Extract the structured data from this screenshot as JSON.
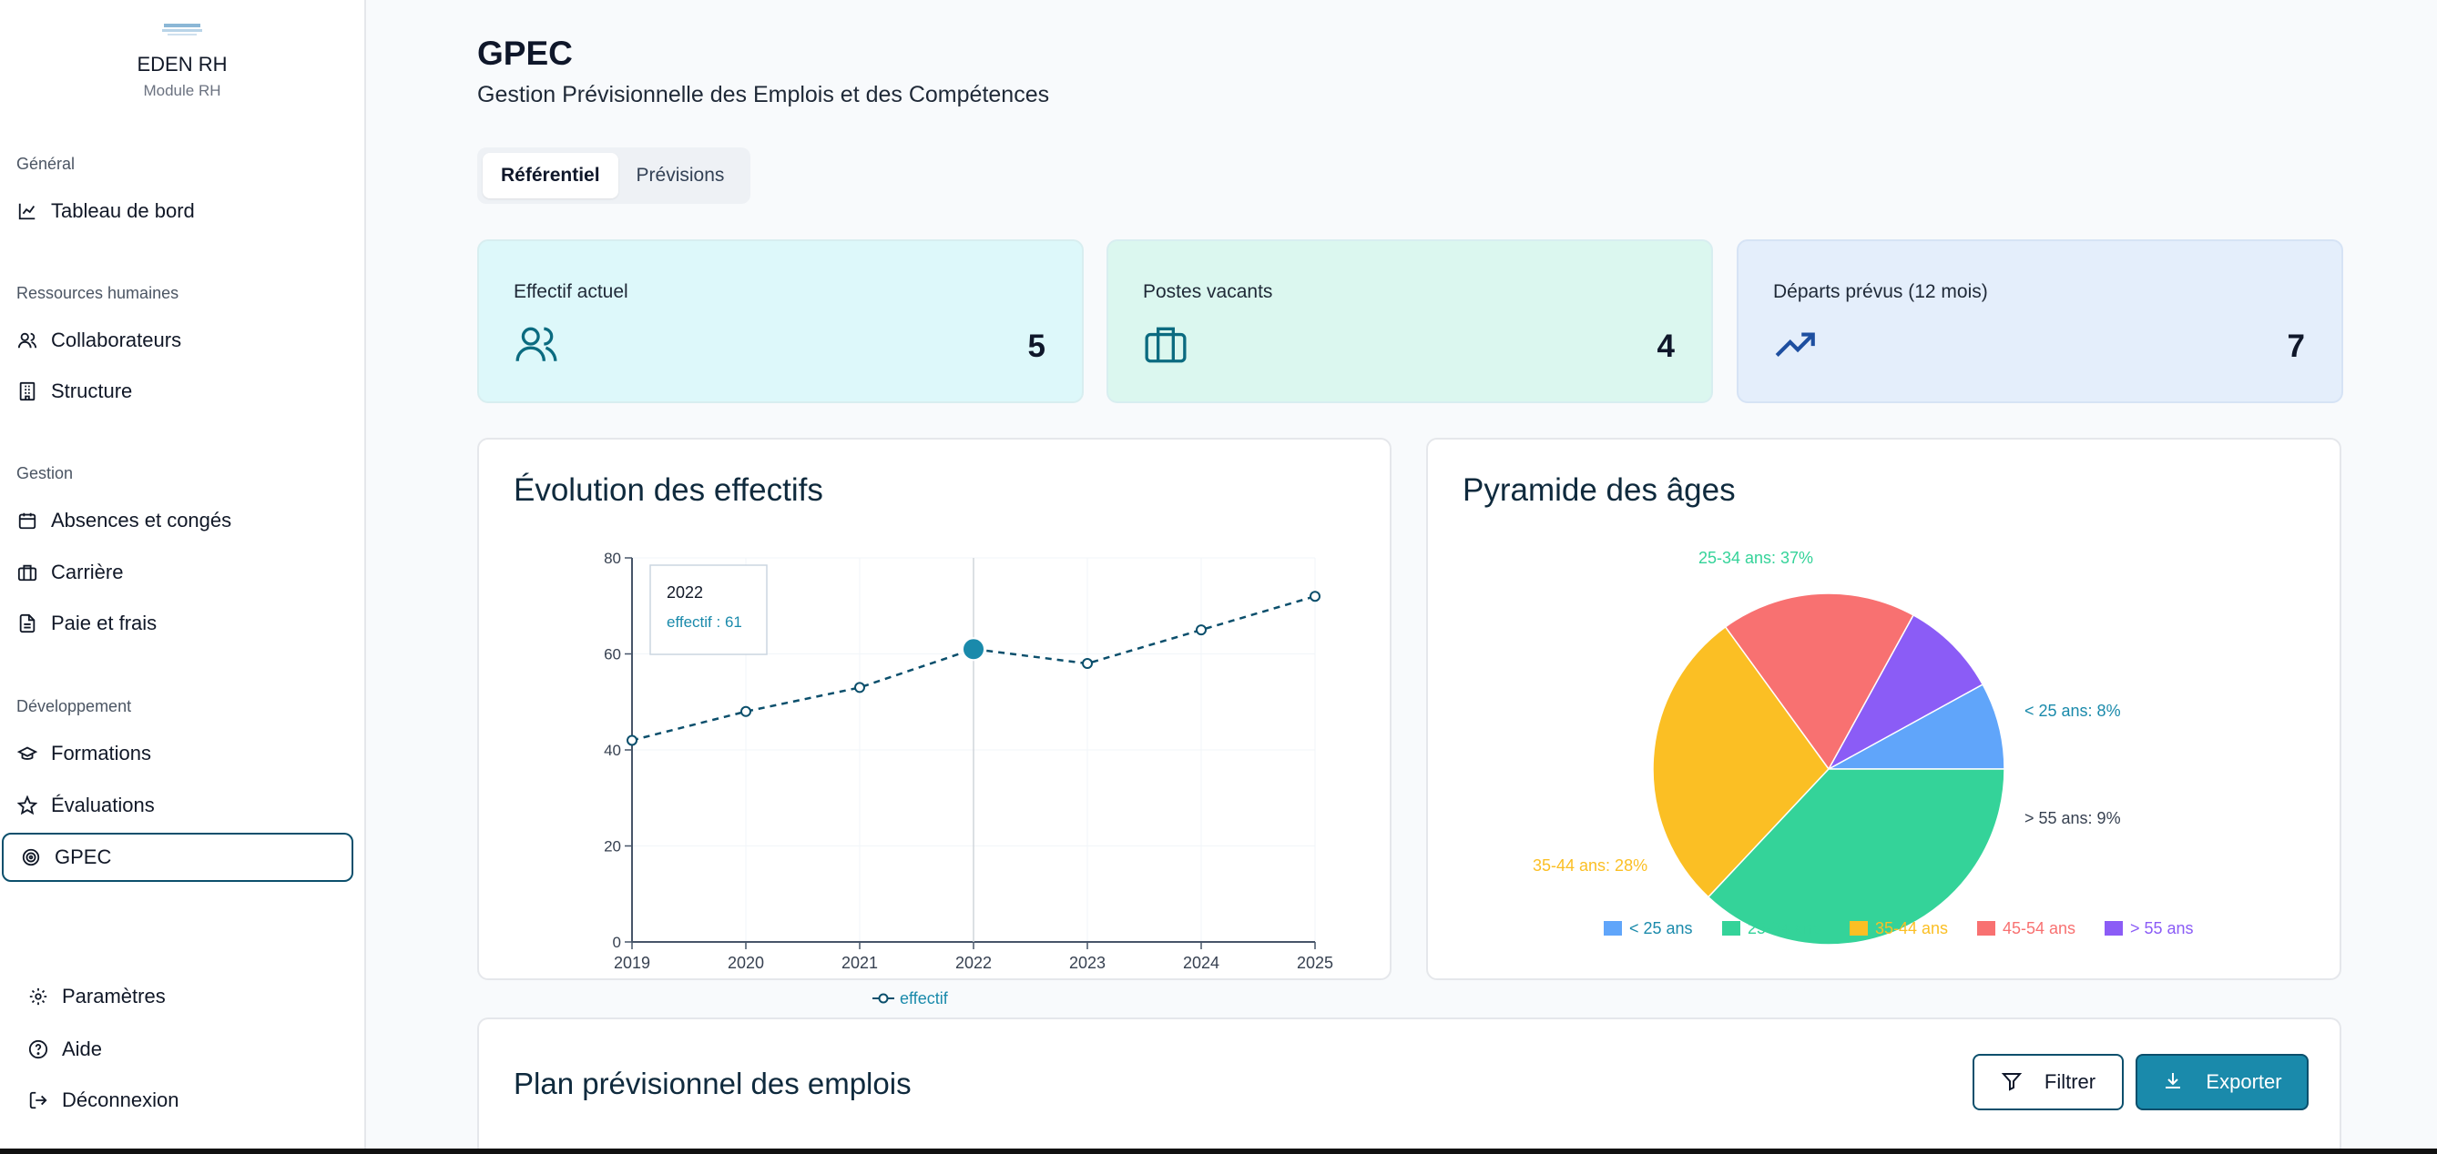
{
  "brand": {
    "name": "EDEN RH",
    "subtitle": "Module RH"
  },
  "sidebar": {
    "sections": [
      {
        "title": "Général"
      },
      {
        "title": "Ressources humaines"
      },
      {
        "title": "Gestion"
      },
      {
        "title": "Développement"
      }
    ],
    "items": [
      {
        "label": "Tableau de bord",
        "icon": "chart-line-icon"
      },
      {
        "label": "Collaborateurs",
        "icon": "users-icon"
      },
      {
        "label": "Structure",
        "icon": "building-icon"
      },
      {
        "label": "Absences et congés",
        "icon": "calendar-icon"
      },
      {
        "label": "Carrière",
        "icon": "briefcase-icon"
      },
      {
        "label": "Paie et frais",
        "icon": "file-icon"
      },
      {
        "label": "Formations",
        "icon": "graduation-cap-icon"
      },
      {
        "label": "Évaluations",
        "icon": "star-icon"
      },
      {
        "label": "GPEC",
        "icon": "target-icon",
        "active": true
      }
    ],
    "bottom": [
      {
        "label": "Paramètres",
        "icon": "gear-icon"
      },
      {
        "label": "Aide",
        "icon": "help-circle-icon"
      },
      {
        "label": "Déconnexion",
        "icon": "logout-icon"
      }
    ]
  },
  "page": {
    "title": "GPEC",
    "subtitle": "Gestion Prévisionnelle des Emplois et des Compétences"
  },
  "tabs": [
    {
      "label": "Référentiel",
      "active": true
    },
    {
      "label": "Prévisions",
      "active": false
    }
  ],
  "stats": [
    {
      "label": "Effectif actuel",
      "value": "5",
      "icon": "users-icon",
      "bg": "#dcf7f8"
    },
    {
      "label": "Postes vacants",
      "value": "4",
      "icon": "briefcase-icon",
      "bg": "#d9f6ef"
    },
    {
      "label": "Départs prévus (12 mois)",
      "value": "7",
      "icon": "trending-up-icon",
      "bg": "#e3edfa"
    }
  ],
  "evolution_panel": {
    "title": "Évolution des effectifs"
  },
  "pyramid_panel": {
    "title": "Pyramide des âges"
  },
  "plan_panel": {
    "title": "Plan prévisionnel des emplois"
  },
  "buttons": {
    "filter": "Filtrer",
    "export": "Exporter"
  },
  "colors": {
    "accent": "#1a8aab",
    "dark": "#0b4f6c"
  },
  "chart_data": [
    {
      "type": "line",
      "x": [
        "2019",
        "2020",
        "2021",
        "2022",
        "2023",
        "2024",
        "2025"
      ],
      "series": [
        {
          "name": "effectif",
          "values": [
            42,
            48,
            53,
            61,
            58,
            65,
            72
          ],
          "color": "#0b4f6c"
        }
      ],
      "ylim": [
        0,
        80
      ],
      "yticks": [
        0,
        20,
        40,
        60,
        80
      ],
      "grid": true,
      "legend": "bottom",
      "tooltip": {
        "title": "2022",
        "text": "effectif : 61",
        "index": 3
      }
    },
    {
      "type": "pie",
      "slices": [
        {
          "label": "< 25 ans",
          "value": 8,
          "color": "#60a5fa",
          "text": "< 25 ans: 8%"
        },
        {
          "label": "> 55 ans",
          "value": 9,
          "color": "#8b5cf6",
          "text": "> 55 ans: 9%"
        },
        {
          "label": "45-54 ans",
          "value": 18,
          "color": "#f87171",
          "text": ""
        },
        {
          "label": "35-44 ans",
          "value": 28,
          "color": "#fbbf24",
          "text": "35-44 ans: 28%"
        },
        {
          "label": "25-34 ans",
          "value": 37,
          "color": "#34d399",
          "text": "25-34 ans: 37%"
        }
      ],
      "legend": [
        "< 25 ans",
        "25-34 ans",
        "35-44 ans",
        "45-54 ans",
        "> 55 ans"
      ],
      "legend_colors": [
        "#60a5fa",
        "#34d399",
        "#fbbf24",
        "#f87171",
        "#8b5cf6"
      ],
      "legend_placement": "bottom"
    }
  ]
}
